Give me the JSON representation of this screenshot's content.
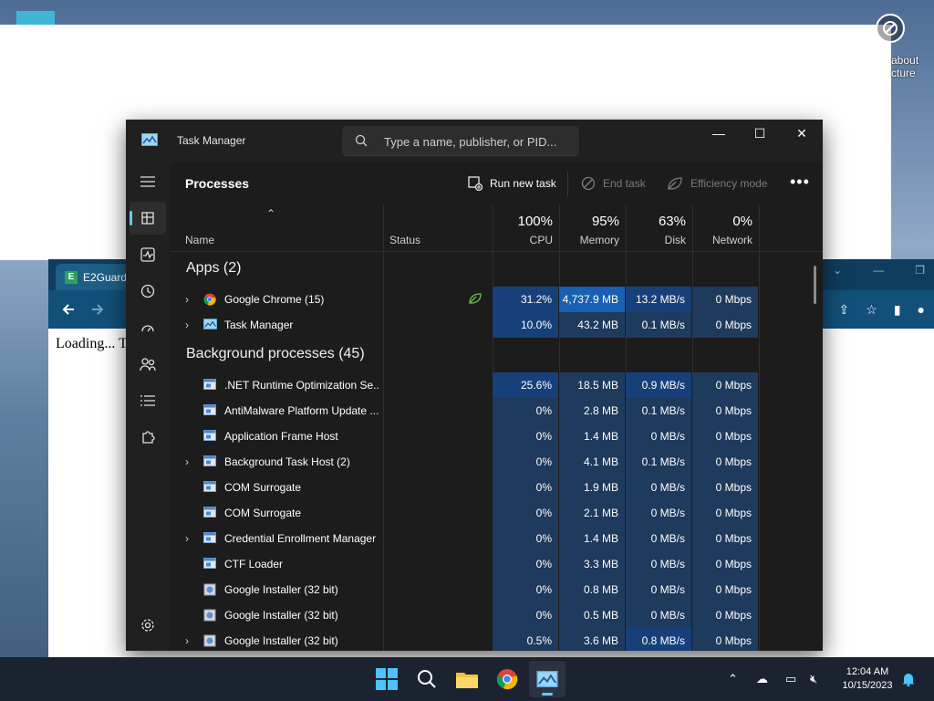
{
  "desktop": {
    "icon_label": "about\ncture"
  },
  "browser": {
    "tab_title": "E2Guard",
    "favicon_letter": "E",
    "content_text": "Loading... T"
  },
  "taskmanager": {
    "title": "Task Manager",
    "search": {
      "placeholder": "Type a name, publisher, or PID..."
    },
    "page_title": "Processes",
    "commands": {
      "run_new_task": "Run new task",
      "end_task": "End task",
      "efficiency_mode": "Efficiency mode",
      "more": "•••"
    },
    "columns": {
      "name": "Name",
      "status": "Status",
      "cpu": {
        "pct": "100%",
        "label": "CPU"
      },
      "memory": {
        "pct": "95%",
        "label": "Memory"
      },
      "disk": {
        "pct": "63%",
        "label": "Disk"
      },
      "network": {
        "pct": "0%",
        "label": "Network"
      }
    },
    "groups": {
      "apps": "Apps (2)",
      "background": "Background processes (45)"
    },
    "apps": [
      {
        "name": "Google Chrome (15)",
        "expand": true,
        "icon": "chrome-icon",
        "status_icon": "efficiency-leaf-icon",
        "cpu": "31.2%",
        "memory": "4,737.9 MB",
        "disk": "13.2 MB/s",
        "network": "0 Mbps"
      },
      {
        "name": "Task Manager",
        "expand": true,
        "icon": "taskmanager-icon",
        "cpu": "10.0%",
        "memory": "43.2 MB",
        "disk": "0.1 MB/s",
        "network": "0 Mbps"
      }
    ],
    "background": [
      {
        "name": ".NET Runtime Optimization Se...",
        "expand": false,
        "icon": "process-icon",
        "cpu": "25.6%",
        "memory": "18.5 MB",
        "disk": "0.9 MB/s",
        "network": "0 Mbps"
      },
      {
        "name": "AntiMalware Platform Update ...",
        "expand": false,
        "icon": "process-icon",
        "cpu": "0%",
        "memory": "2.8 MB",
        "disk": "0.1 MB/s",
        "network": "0 Mbps"
      },
      {
        "name": "Application Frame Host",
        "expand": false,
        "icon": "process-icon",
        "cpu": "0%",
        "memory": "1.4 MB",
        "disk": "0 MB/s",
        "network": "0 Mbps"
      },
      {
        "name": "Background Task Host (2)",
        "expand": true,
        "icon": "process-icon",
        "cpu": "0%",
        "memory": "4.1 MB",
        "disk": "0.1 MB/s",
        "network": "0 Mbps"
      },
      {
        "name": "COM Surrogate",
        "expand": false,
        "icon": "process-icon",
        "cpu": "0%",
        "memory": "1.9 MB",
        "disk": "0 MB/s",
        "network": "0 Mbps"
      },
      {
        "name": "COM Surrogate",
        "expand": false,
        "icon": "process-icon",
        "cpu": "0%",
        "memory": "2.1 MB",
        "disk": "0 MB/s",
        "network": "0 Mbps"
      },
      {
        "name": "Credential Enrollment Manager",
        "expand": true,
        "icon": "process-icon",
        "cpu": "0%",
        "memory": "1.4 MB",
        "disk": "0 MB/s",
        "network": "0 Mbps"
      },
      {
        "name": "CTF Loader",
        "expand": false,
        "icon": "process-icon",
        "cpu": "0%",
        "memory": "3.3 MB",
        "disk": "0 MB/s",
        "network": "0 Mbps"
      },
      {
        "name": "Google Installer (32 bit)",
        "expand": false,
        "icon": "installer-icon",
        "cpu": "0%",
        "memory": "0.8 MB",
        "disk": "0 MB/s",
        "network": "0 Mbps"
      },
      {
        "name": "Google Installer (32 bit)",
        "expand": false,
        "icon": "installer-icon",
        "cpu": "0%",
        "memory": "0.5 MB",
        "disk": "0 MB/s",
        "network": "0 Mbps"
      },
      {
        "name": "Google Installer (32 bit)",
        "expand": true,
        "icon": "installer-icon",
        "cpu": "0.5%",
        "memory": "3.6 MB",
        "disk": "0.8 MB/s",
        "network": "0 Mbps"
      }
    ]
  },
  "taskbar": {
    "time": "12:04 AM",
    "date": "10/15/2023"
  },
  "colors": {
    "heat_low": "#1e3a5c",
    "heat_mid": "#17407a",
    "heat_high": "#1760b4",
    "accent": "#60cdff"
  }
}
